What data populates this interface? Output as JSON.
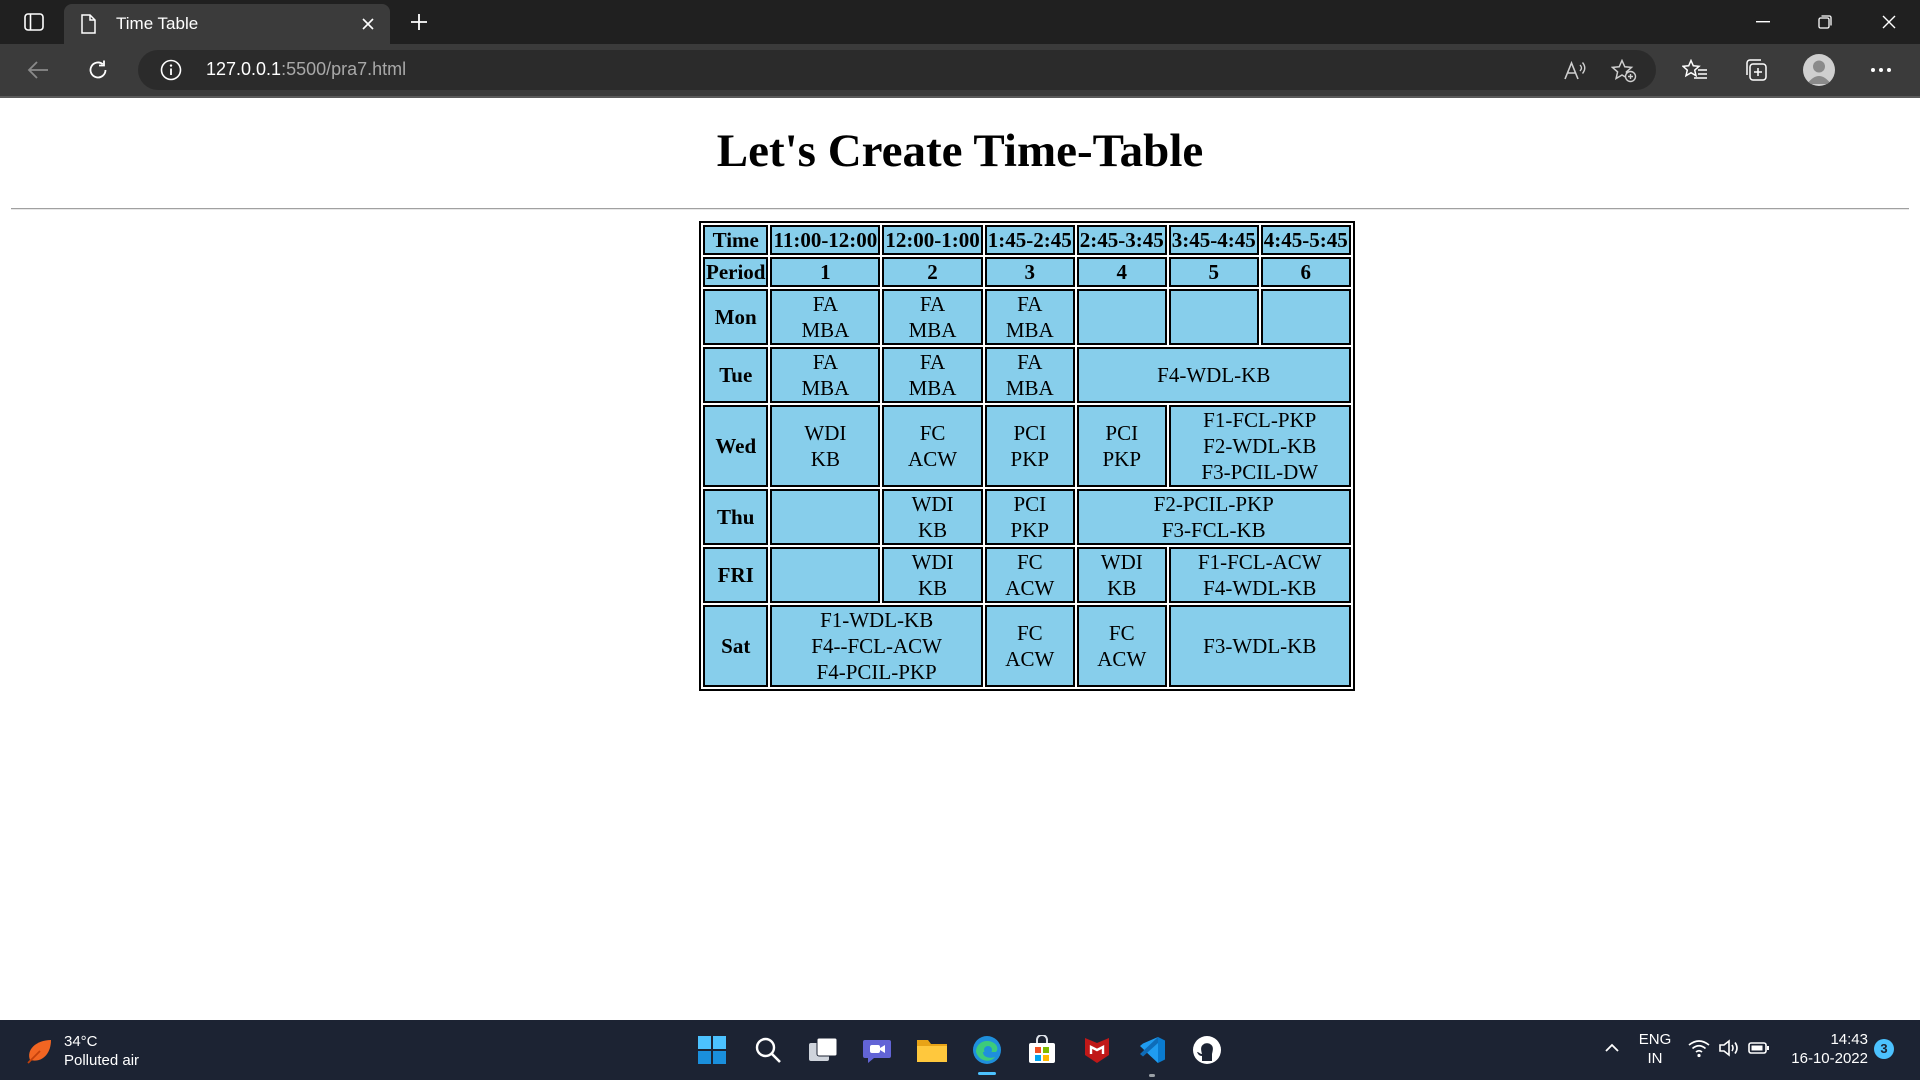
{
  "browser": {
    "tab_title": "Time Table",
    "url_host": "127.0.0.1",
    "url_rest": ":5500/pra7.html"
  },
  "page": {
    "title": "Let's Create Time-Table"
  },
  "timetable": {
    "time_label": "Time",
    "period_label": "Period",
    "times": [
      "11:00-12:00",
      "12:00-1:00",
      "1:45-2:45",
      "2:45-3:45",
      "3:45-4:45",
      "4:45-5:45"
    ],
    "periods": [
      "1",
      "2",
      "3",
      "4",
      "5",
      "6"
    ],
    "days": {
      "mon": {
        "label": "Mon",
        "p1": [
          "FA",
          "MBA"
        ],
        "p2": [
          "FA",
          "MBA"
        ],
        "p3": [
          "FA",
          "MBA"
        ]
      },
      "tue": {
        "label": "Tue",
        "p1": [
          "FA",
          "MBA"
        ],
        "p2": [
          "FA",
          "MBA"
        ],
        "p3": [
          "FA",
          "MBA"
        ],
        "p456": "F4-WDL-KB"
      },
      "wed": {
        "label": "Wed",
        "p1": [
          "WDI",
          "KB"
        ],
        "p2": [
          "FC",
          "ACW"
        ],
        "p3": [
          "PCI",
          "PKP"
        ],
        "p4": [
          "PCI",
          "PKP"
        ],
        "p56": [
          "F1-FCL-PKP",
          "F2-WDL-KB",
          "F3-PCIL-DW"
        ]
      },
      "thu": {
        "label": "Thu",
        "p2": [
          "WDI",
          "KB"
        ],
        "p3": [
          "PCI",
          "PKP"
        ],
        "p456": [
          "F2-PCIL-PKP",
          "F3-FCL-KB"
        ]
      },
      "fri": {
        "label": "FRI",
        "p2": [
          "WDI",
          "KB"
        ],
        "p3": [
          "FC",
          "ACW"
        ],
        "p4": [
          "WDI",
          "KB"
        ],
        "p56": [
          "F1-FCL-ACW",
          "F4-WDL-KB"
        ]
      },
      "sat": {
        "label": "Sat",
        "p12": [
          "F1-WDL-KB",
          "F4--FCL-ACW",
          "F4-PCIL-PKP"
        ],
        "p3": [
          "FC",
          "ACW"
        ],
        "p4": [
          "FC",
          "ACW"
        ],
        "p56": "F3-WDL-KB"
      }
    }
  },
  "taskbar": {
    "weather_temp": "34°C",
    "weather_desc": "Polluted air",
    "lang_top": "ENG",
    "lang_bottom": "IN",
    "time": "14:43",
    "date": "16-10-2022",
    "notifications": "3"
  }
}
